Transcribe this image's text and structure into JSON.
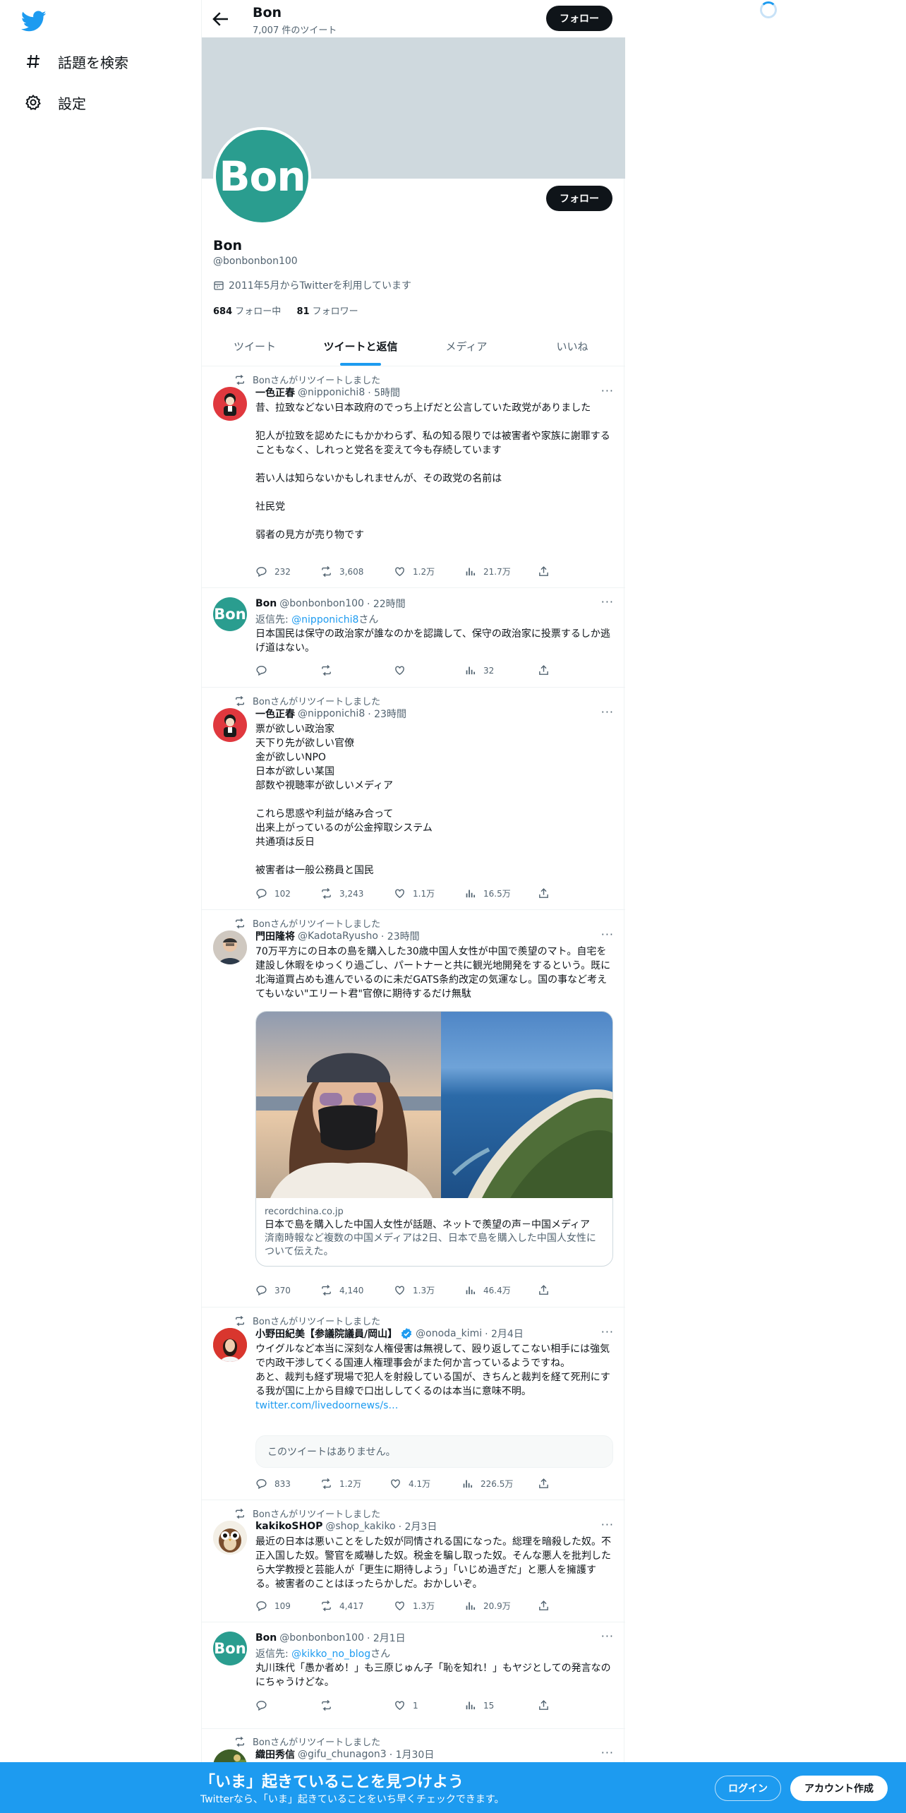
{
  "nav": {
    "explore": "話題を検索",
    "settings": "設定"
  },
  "header": {
    "name": "Bon",
    "tweet_count": "7,007 件のツイート",
    "follow": "フォロー"
  },
  "profile": {
    "avatar_text": "Bon",
    "name": "Bon",
    "handle": "@bonbonbon100",
    "joined": "2011年5月からTwitterを利用しています",
    "following_count": "684",
    "following_label": "フォロー中",
    "followers_count": "81",
    "followers_label": "フォロワー",
    "follow": "フォロー"
  },
  "tabs": [
    "ツイート",
    "ツイートと返信",
    "メディア",
    "いいね"
  ],
  "active_tab": "ツイートと返信",
  "tweets": [
    {
      "retweeted_by": "Bonさんがリツイートしました",
      "name": "一色正春",
      "handle": "@nipponichi8",
      "time": "· 5時間",
      "text": "昔、拉致などない日本政府のでっち上げだと公言していた政党がありました\n\n犯人が拉致を認めたにもかかわらず、私の知る限りでは被害者や家族に謝罪することもなく、しれっと党名を変えて今も存続しています\n\n若い人は知らないかもしれませんが、その政党の名前は\n\n社民党\n\n弱者の見方が売り物です",
      "replies": "232",
      "retweets": "3,608",
      "likes": "1.2万",
      "views": "21.7万"
    },
    {
      "avatar_text": "Bon",
      "name": "Bon",
      "handle": "@bonbonbon100",
      "time": "· 22時間",
      "reply_prefix": "返信先: ",
      "reply_handle": "@nipponichi8",
      "reply_suffix": "さん",
      "text": "日本国民は保守の政治家が誰なのかを認識して、保守の政治家に投票するしか逃げ道はない。",
      "replies": "",
      "retweets": "",
      "likes": "",
      "views": "32"
    },
    {
      "retweeted_by": "Bonさんがリツイートしました",
      "name": "一色正春",
      "handle": "@nipponichi8",
      "time": "· 23時間",
      "text": "票が欲しい政治家\n天下り先が欲しい官僚\n金が欲しいNPO\n日本が欲しい某国\n部数や視聴率が欲しいメディア\n\nこれら思惑や利益が絡み合って\n出来上がっているのが公金搾取システム\n共通項は反日\n\n被害者は一般公務員と国民",
      "replies": "102",
      "retweets": "3,243",
      "likes": "1.1万",
      "views": "16.5万"
    },
    {
      "retweeted_by": "Bonさんがリツイートしました",
      "name": "門田隆将",
      "handle": "@KadotaRyusho",
      "time": "· 23時間",
      "text": "70万平方にの日本の島を購入した30歳中国人女性が中国で羨望のマト。自宅を建設し休暇をゆっくり過ごし、パートナーと共に観光地開発をするという。既に北海道買占めも進んでいるのに未だGATS条約改定の気運なし。国の事など考えてもいない\"エリート君\"官僚に期待するだけ無駄",
      "card_domain": "recordchina.co.jp",
      "card_title": "日本で島を購入した中国人女性が話題、ネットで羨望の声－中国メディア",
      "card_desc": "済南時報など複数の中国メディアは2日、日本で島を購入した中国人女性について伝えた。",
      "replies": "370",
      "retweets": "4,140",
      "likes": "1.3万",
      "views": "46.4万"
    },
    {
      "retweeted_by": "Bonさんがリツイートしました",
      "name": "小野田紀美【参議院議員/岡山】",
      "handle": "@onoda_kimi",
      "time": "· 2月4日",
      "text": "ウイグルなど本当に深刻な人権侵害は無視して、殴り返してこない相手には強気で内政干渉してくる国連人権理事会がまた何か言っているようですね。\nあと、裁判も経ず現場で犯人を射殺している国が、きちんと裁判を経て死刑にする我が国に上から目線で口出ししてくるのは本当に意味不明。",
      "link": "twitter.com/livedoornews/s…",
      "unavailable": "このツイートはありません。",
      "replies": "833",
      "retweets": "1.2万",
      "likes": "4.1万",
      "views": "226.5万"
    },
    {
      "retweeted_by": "Bonさんがリツイートしました",
      "name": "kakikoSHOP",
      "handle": "@shop_kakiko",
      "time": "· 2月3日",
      "text": "最近の日本は悪いことをした奴が同情される国になった。総理を暗殺した奴。不正入国した奴。警官を威嚇した奴。税金を騙し取った奴。そんな悪人を批判したら大学教授と芸能人が「更生に期待しよう」「いじめ過ぎだ」と悪人を擁護する。被害者のことはほったらかしだ。おかしいぞ。",
      "replies": "109",
      "retweets": "4,417",
      "likes": "1.3万",
      "views": "20.9万"
    },
    {
      "avatar_text": "Bon",
      "name": "Bon",
      "handle": "@bonbonbon100",
      "time": "· 2月1日",
      "reply_prefix": "返信先: ",
      "reply_handle": "@kikko_no_blog",
      "reply_suffix": "さん",
      "text": "丸川珠代「愚か者め！」も三原じゅん子「恥を知れ！」もヤジとしての発言なのにちゃうけどな。",
      "replies": "",
      "retweets": "",
      "likes": "1",
      "views": "15"
    },
    {
      "retweeted_by": "Bonさんがリツイートしました",
      "name": "織田秀信",
      "handle": "@gifu_chunagon3",
      "time": "· 1月30日"
    }
  ],
  "bottom": {
    "title": "「いま」起きていることを見つけよう",
    "subtitle": "Twitterなら、「いま」起きていることをいち早くチェックできます。",
    "login": "ログイン",
    "signup": "アカウント作成"
  },
  "colors": {
    "accent": "#1d9bf0",
    "avatar_bon": "#2a9d8f",
    "banner": "#cfd9de",
    "verified": "#1d9bf0"
  }
}
